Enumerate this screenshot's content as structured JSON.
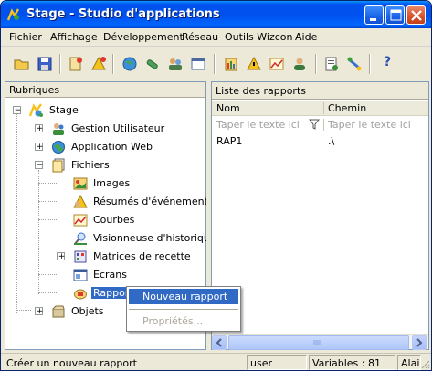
{
  "window": {
    "title": "Stage - Studio d'applications",
    "controls": [
      "minimize",
      "maximize",
      "close"
    ]
  },
  "menu": [
    "Fichier",
    "Affichage",
    "Développement",
    "Réseau",
    "Outils Wizcon",
    "Aide"
  ],
  "toolbar": {
    "buttons": [
      "open-folder",
      "save",
      "add-page",
      "add-alert",
      "globe",
      "link",
      "people",
      "window-list",
      "report",
      "warning",
      "chart",
      "user",
      "print-settings",
      "network",
      "help"
    ],
    "help_label": "?"
  },
  "left_pane": {
    "header": "Rubriques",
    "tree": {
      "root": "Stage",
      "items": [
        {
          "label": "Gestion Utilisateur",
          "expander": "+"
        },
        {
          "label": "Application Web",
          "expander": "+"
        },
        {
          "label": "Fichiers",
          "expander": "−"
        },
        {
          "label": "Images"
        },
        {
          "label": "Résumés d'événements"
        },
        {
          "label": "Courbes"
        },
        {
          "label": "Visionneuse d'historique"
        },
        {
          "label": "Matrices de recette",
          "expander": "+"
        },
        {
          "label": "Ecrans"
        },
        {
          "label": "Rappor",
          "selected": true
        },
        {
          "label": "Objets",
          "expander": "+"
        }
      ],
      "root_expander": "−"
    }
  },
  "right_pane": {
    "header": "Liste des rapports",
    "columns": [
      "Nom",
      "Chemin"
    ],
    "filter_placeholder": [
      "Taper le texte ici",
      "Taper le texte ici"
    ],
    "rows": [
      {
        "nom": "RAP1",
        "chemin": ".\\"
      }
    ]
  },
  "context_menu": {
    "items": [
      {
        "label": "Nouveau rapport",
        "highlighted": true
      },
      {
        "label": "Propriétés...",
        "disabled": true
      }
    ]
  },
  "status_bar": {
    "message": "Créer un nouveau rapport",
    "user": "user",
    "variables": "Variables : 81",
    "alarm": "Alai"
  },
  "colors": {
    "title_bar": "#0053ee",
    "selection": "#316ac5",
    "window_bg": "#ece9d8"
  }
}
